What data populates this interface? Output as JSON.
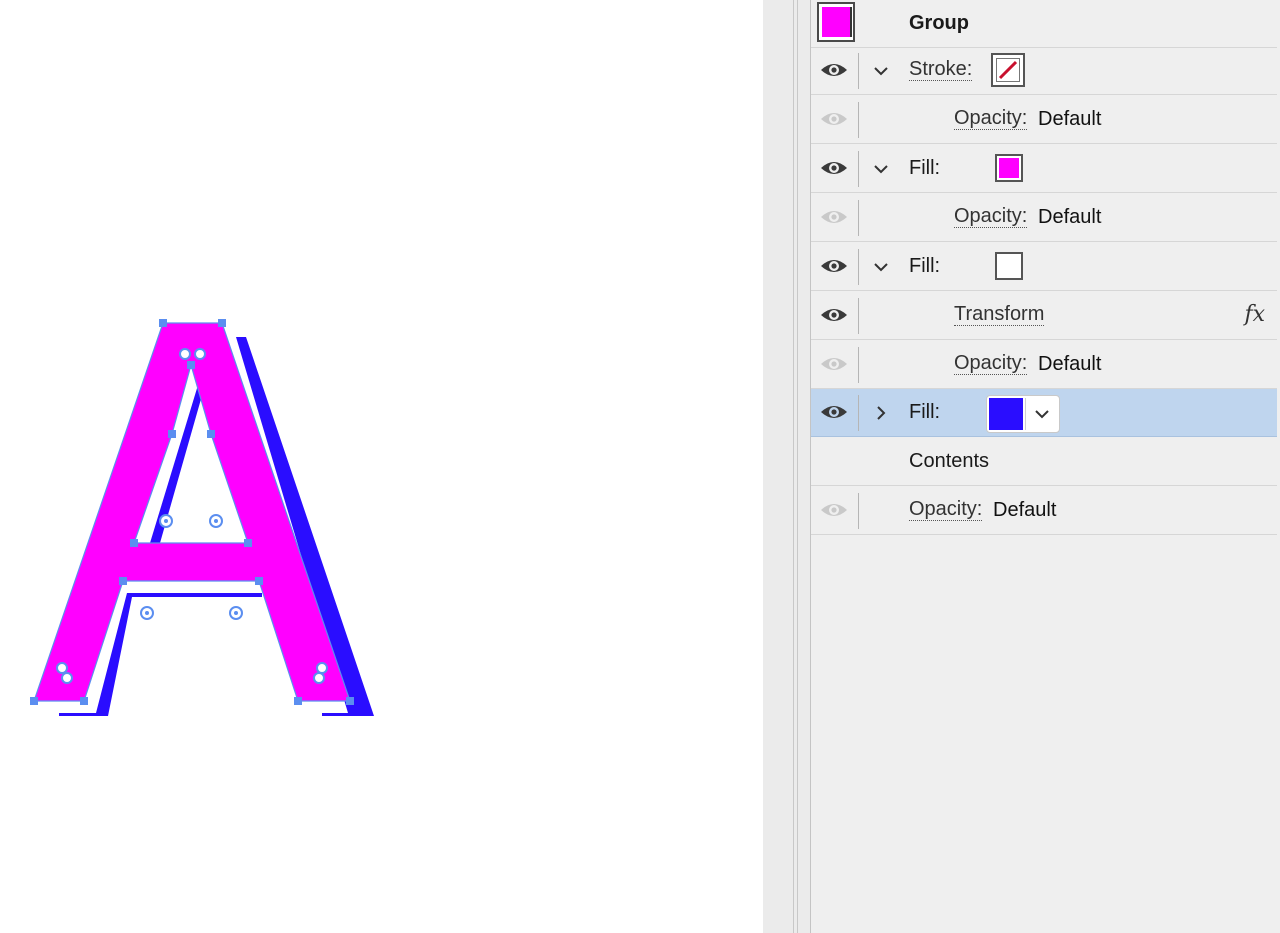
{
  "panel": {
    "group": {
      "label": "Group",
      "swatch_color": "#ff00ff"
    },
    "stroke": {
      "label": "Stroke:",
      "swatch_icon": "none-slash-icon",
      "opacity_label": "Opacity:",
      "opacity_value": "Default"
    },
    "fill1": {
      "label": "Fill:",
      "color": "#ff00ff",
      "opacity_label": "Opacity:",
      "opacity_value": "Default"
    },
    "fill2": {
      "label": "Fill:",
      "color": "#ffffff",
      "effect_label": "Transform",
      "effect_icon": "fx-icon",
      "effect_glyph": "fx",
      "opacity_label": "Opacity:",
      "opacity_value": "Default"
    },
    "fill3": {
      "label": "Fill:",
      "color": "#2a0dff",
      "expanded": false,
      "selected": true
    },
    "contents": {
      "label": "Contents"
    },
    "object_opacity": {
      "label": "Opacity:",
      "value": "Default"
    }
  },
  "canvas": {
    "glyph": "A",
    "fill_colors": [
      "#ff00ff",
      "#2a0dff"
    ],
    "selection_color": "#5b8ef0"
  },
  "colors": {
    "panel_bg": "#efefef",
    "selection_bg": "#bfd5ee",
    "accent": "#5b8ef0"
  }
}
